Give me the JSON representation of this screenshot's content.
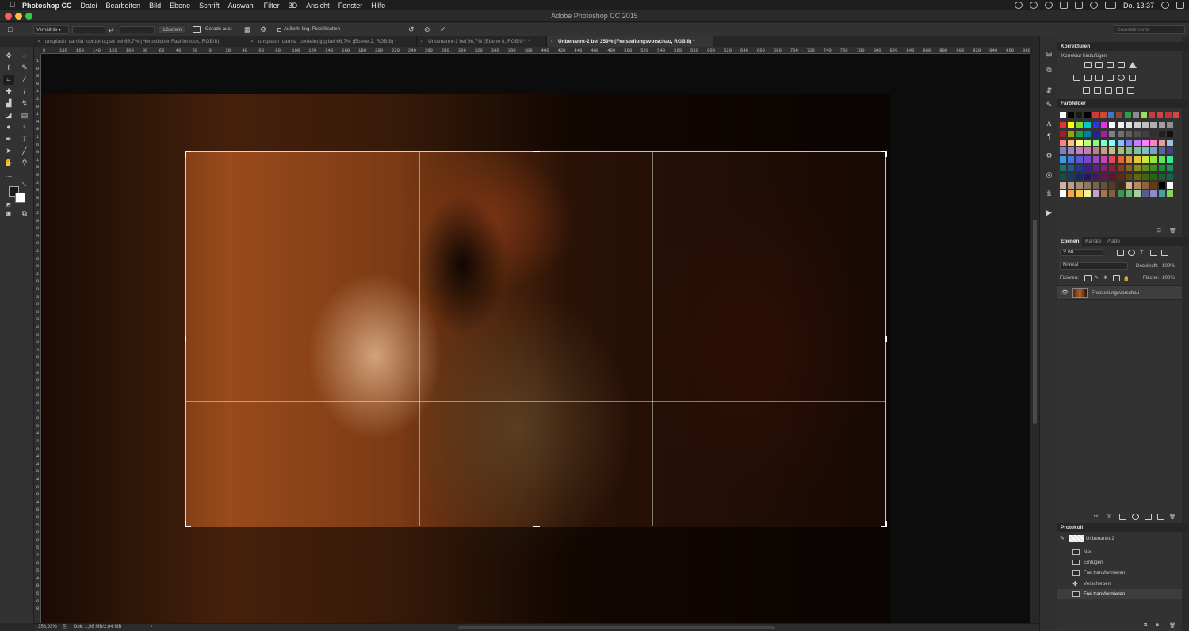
{
  "menubar": {
    "items": [
      "Photoshop CC",
      "Datei",
      "Bearbeiten",
      "Bild",
      "Ebene",
      "Schrift",
      "Auswahl",
      "Filter",
      "3D",
      "Ansicht",
      "Fenster",
      "Hilfe"
    ],
    "clock": "Do. 13:37"
  },
  "window": {
    "title": "Adobe Photoshop CC 2015"
  },
  "options": {
    "ratio_label": "Verhältnis",
    "clear_button": "Löschen",
    "straighten_label": "Gerade ausr.",
    "delete_pixels_label": "Außerh. lieg. Pixel löschen",
    "workspace": "Grundelemente"
  },
  "tabs": [
    {
      "label": "unsplash_camila_cordeiro.psd bei 66,7% (Herbstlicher Fashionlook, RGB/8)",
      "active": false
    },
    {
      "label": "unsplash_camila_cordeiro.jpg bei 66,7% (Ebene 2, RGB/8) *",
      "active": false
    },
    {
      "label": "Unbenannt-1 bei 66,7% (Ebene 8, RGB/8*) *",
      "active": false
    },
    {
      "label": "Unbenannt-2 bei 359% (Freistellungsvorschau, RGB/8) *",
      "active": true
    }
  ],
  "hruler": [
    "0",
    "180",
    "160",
    "140",
    "120",
    "100",
    "80",
    "60",
    "40",
    "20",
    "0",
    "20",
    "40",
    "60",
    "80",
    "100",
    "120",
    "140",
    "160",
    "180",
    "200",
    "220",
    "240",
    "260",
    "280",
    "300",
    "320",
    "340",
    "360",
    "380",
    "400",
    "420",
    "440",
    "460",
    "480",
    "500",
    "520",
    "540",
    "560",
    "580",
    "600",
    "620",
    "640",
    "660",
    "680",
    "700",
    "720",
    "740",
    "760",
    "780",
    "800",
    "820",
    "840",
    "860",
    "880",
    "900",
    "920",
    "940",
    "960",
    "980",
    "1000"
  ],
  "vruler": [
    "1",
    "0",
    "0",
    "0",
    "1",
    "2",
    "0",
    "1",
    "4",
    "0",
    "1",
    "6",
    "0",
    "1",
    "8",
    "0",
    "2",
    "0",
    "0",
    "2",
    "2",
    "0",
    "2",
    "4",
    "0",
    "2",
    "6",
    "0",
    "2",
    "8",
    "0",
    "3",
    "0",
    "0",
    "3",
    "2",
    "0",
    "3",
    "4",
    "0",
    "3",
    "6",
    "0",
    "3",
    "8",
    "0",
    "4",
    "0",
    "0",
    "4",
    "2",
    "0",
    "4",
    "4",
    "0",
    "4",
    "6",
    "0",
    "4",
    "8",
    "0",
    "5",
    "0",
    "0",
    "5",
    "2",
    "0",
    "5",
    "4",
    "0",
    "5",
    "6",
    "0"
  ],
  "status": {
    "zoom": "358,93%",
    "doc": "Dok: 1,98 MB/2,64 MB"
  },
  "panels": {
    "adjustments": {
      "title": "Korrekturen",
      "subtitle": "Korrektur hinzufügen"
    },
    "swatches": {
      "title": "Farbfelder"
    },
    "layers": {
      "tabs": [
        "Ebenen",
        "Kanäle",
        "Pfade"
      ],
      "filter": "Art",
      "blend_mode": "Normal",
      "opacity_label": "Deckkraft:",
      "opacity": "100%",
      "lock_label": "Fixieren:",
      "fill_label": "Fläche:",
      "fill": "100%",
      "layer_name": "Freistellungsvorschau"
    },
    "history": {
      "title": "Protokoll",
      "snapshot": "Unbenannt-2",
      "items": [
        "Neu",
        "Einfügen",
        "Frei transformieren",
        "Verschieben",
        "Frei transformieren"
      ]
    }
  },
  "swatch_colors": {
    "row1": [
      "#ffffff",
      "#000000",
      "#1a1a1a",
      "#000000",
      "#c83c3c",
      "#d24632",
      "#3c78c8",
      "#8c4632",
      "#28a046",
      "#8c8c8c",
      "#a0dc5a",
      "#c83c3c",
      "#c84646",
      "#c83232",
      "#d24646"
    ],
    "grid": [
      [
        "#e63232",
        "#ffff00",
        "#82dc32",
        "#00c8c8",
        "#3232e6",
        "#e632e6",
        "#ffffff",
        "#f0f0f0",
        "#e0e0e0",
        "#d0d0d0",
        "#c0c0c0",
        "#b0b0b0",
        "#a0a0a0",
        "#909090"
      ],
      [
        "#a02020",
        "#a0a000",
        "#20a040",
        "#0080a0",
        "#2020a0",
        "#a020a0",
        "#808080",
        "#707070",
        "#606060",
        "#505050",
        "#404040",
        "#303030",
        "#202020",
        "#101010"
      ],
      [
        "#ff8080",
        "#ffc080",
        "#ffff80",
        "#c0ff80",
        "#80ff80",
        "#80ffc0",
        "#80ffff",
        "#80c0ff",
        "#8080ff",
        "#c080ff",
        "#ff80ff",
        "#ff80c0",
        "#e0a0a0",
        "#a0c0e0"
      ],
      [
        "#8080c0",
        "#a080c0",
        "#c080c0",
        "#c080a0",
        "#c08080",
        "#c0a080",
        "#c0c080",
        "#a0c080",
        "#80c080",
        "#80c0a0",
        "#80c0c0",
        "#80a0c0",
        "#6060a0",
        "#404080"
      ],
      [
        "#3c9ae6",
        "#3c78e6",
        "#5a5ad2",
        "#7846c8",
        "#a046c8",
        "#c846b4",
        "#e6465a",
        "#e6643c",
        "#e6963c",
        "#e6c83c",
        "#c8e63c",
        "#96e63c",
        "#5ae65a",
        "#3ce696"
      ],
      [
        "#1e6e6e",
        "#1e5a8c",
        "#1e3c8c",
        "#3c1e8c",
        "#641e8c",
        "#8c1e6e",
        "#8c1e3c",
        "#8c3c1e",
        "#8c641e",
        "#8c8c1e",
        "#648c1e",
        "#3c8c1e",
        "#1e8c3c",
        "#1e8c64"
      ],
      [
        "#145050",
        "#143c64",
        "#142864",
        "#281464",
        "#461464",
        "#641450",
        "#641428",
        "#642814",
        "#644614",
        "#646414",
        "#466414",
        "#286414",
        "#146428",
        "#146446"
      ],
      [
        "#c8b4a0",
        "#b4a08c",
        "#a08c78",
        "#8c7864",
        "#786450",
        "#64503c",
        "#503c28",
        "#3c2814",
        "#d2b48c",
        "#b48c64",
        "#8c643c",
        "#643c14",
        "#000000",
        "#ffffff"
      ],
      [
        "#ffffff",
        "#f5a64a",
        "#f5c84a",
        "#f0f0a0",
        "#c8a0c8",
        "#a07850",
        "#806040",
        "#3c9650",
        "#64b478",
        "#a0d2a0",
        "#5a5a8c",
        "#8c8cc8",
        "#46a0a0",
        "#8cd25a"
      ]
    ]
  }
}
